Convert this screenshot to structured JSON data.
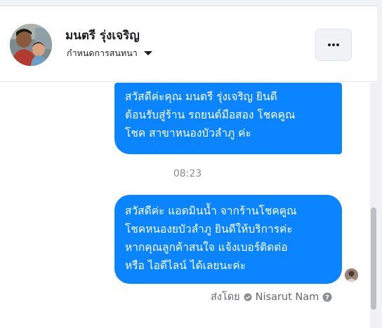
{
  "header": {
    "contact_name": "มนตรี รุ่งเจริญ",
    "subtitle": "กำหนดการสนทนา",
    "icons": {
      "avatar": "profile-photo",
      "caret": "caret-down-icon",
      "more": "more-options-icon"
    }
  },
  "messages": [
    {
      "direction": "outgoing",
      "lines": [
        "สวัสดีค่ะคุณ มนตรี รุ่งเจริญ ยินดี",
        "ต้อนรับสู่ร้าน รถยนต์มือสอง โชคคูณ",
        "โชค สาขาหนองบัวลำภู ค่ะ"
      ]
    },
    {
      "direction": "outgoing",
      "lines": [
        "สวัสดีค่ะ แอดมินน้ำ จากร้านโชคคูณ",
        "โชคหนองยบัวลำภู ยินดีให้บริการค่ะ",
        "หากคุณลูกค้าสนใจ แจ้งเบอร์ติดต่อ",
        "หรือ ไอดีไลน์ ได้เลยนะค่ะ"
      ]
    }
  ],
  "timestamp": "08:23",
  "sent_by": {
    "prefix": "ส่งโดย",
    "sender": "Nisarut Nam"
  },
  "colors": {
    "bubble": "#0a84ff",
    "bubble_text": "#ffffff",
    "meta_text": "#65676b"
  }
}
